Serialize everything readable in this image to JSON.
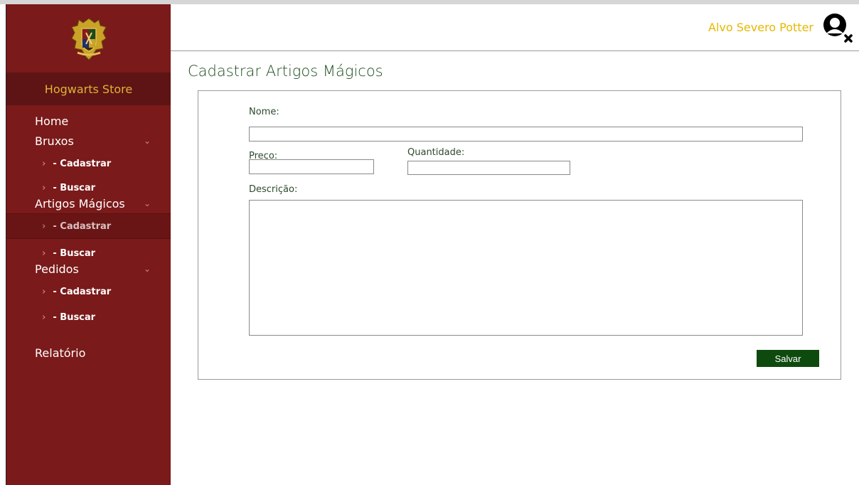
{
  "header": {
    "user_name": "Alvo Severo Potter",
    "avatar_icon": "user-remove-icon"
  },
  "sidebar": {
    "logo_icon": "hogwarts-crest-icon",
    "store_title": "Hogwarts Store",
    "items": [
      {
        "label": "Home"
      },
      {
        "label": "Bruxos",
        "sub": [
          "- Cadastrar",
          "- Buscar"
        ]
      },
      {
        "label": "Artigos Mágicos",
        "sub": [
          "- Cadastrar",
          "- Buscar"
        ],
        "active_sub": 0
      },
      {
        "label": "Pedidos",
        "sub": [
          "- Cadastrar",
          "- Buscar"
        ]
      },
      {
        "label": "Relatório"
      }
    ]
  },
  "main": {
    "title": "Cadastrar Artigos Mágicos",
    "form": {
      "nome_label": "Nome:",
      "nome_value": "",
      "preco_label": "Preço:",
      "preco_value": "",
      "quantidade_label": "Quantidade:",
      "quantidade_value": "",
      "descricao_label": "Descrição:",
      "descricao_value": "",
      "submit_label": "Salvar"
    }
  },
  "colors": {
    "sidebar": "#7b1a1a",
    "accent_gold": "#e6b800",
    "primary_green": "#0e4a0e"
  }
}
